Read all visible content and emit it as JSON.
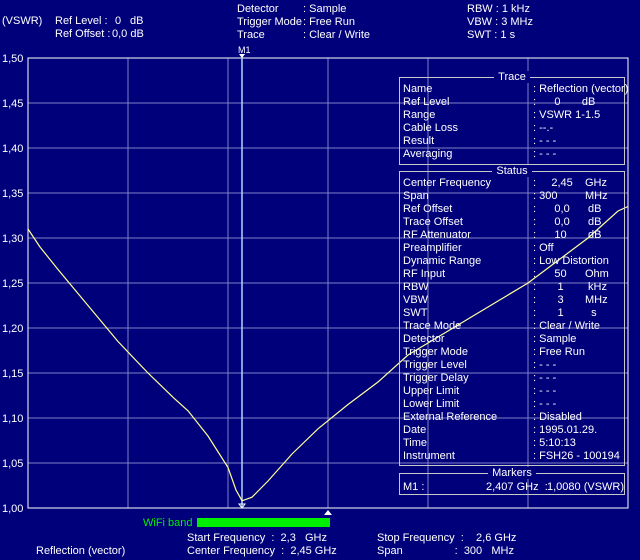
{
  "header": {
    "unit": "(VSWR)",
    "ref_level_label": "Ref Level :",
    "ref_level_value": "0",
    "ref_level_unit": "dB",
    "ref_offset_label": "Ref Offset :",
    "ref_offset_value": "0,0 dB",
    "detector_label": "Detector",
    "detector_value": ": Sample",
    "trigger_label": "Trigger Mode",
    "trigger_value": ": Free Run",
    "trace_label": "Trace",
    "trace_value": ": Clear / Write",
    "rbw": "RBW : 1 kHz",
    "vbw": "VBW : 3 MHz",
    "swt": "SWT : 1 s"
  },
  "marker_label": "M1",
  "colors": {
    "background": "#00007a",
    "trace": "#ffff99",
    "grid": "#8080c8",
    "wifi": "#00ee00",
    "marker": "#ffffff"
  },
  "chart_data": {
    "type": "line",
    "xlim": [
      2300,
      2600
    ],
    "ylim": [
      1.0,
      1.5
    ],
    "y_ticks": [
      "1,50",
      "1,45",
      "1,40",
      "1,35",
      "1,30",
      "1,25",
      "1,20",
      "1,15",
      "1,10",
      "1,05",
      "1,00"
    ],
    "marker": {
      "name": "M1",
      "x": 2407,
      "y": 1.008
    },
    "series": [
      {
        "values": [
          [
            2300,
            1.31
          ],
          [
            2306,
            1.29
          ],
          [
            2315,
            1.265
          ],
          [
            2330,
            1.225
          ],
          [
            2345,
            1.185
          ],
          [
            2360,
            1.15
          ],
          [
            2373,
            1.122
          ],
          [
            2380,
            1.108
          ],
          [
            2390,
            1.08
          ],
          [
            2400,
            1.045
          ],
          [
            2404,
            1.02
          ],
          [
            2407,
            1.008
          ],
          [
            2412,
            1.012
          ],
          [
            2420,
            1.03
          ],
          [
            2432,
            1.06
          ],
          [
            2445,
            1.088
          ],
          [
            2460,
            1.115
          ],
          [
            2475,
            1.14
          ],
          [
            2490,
            1.17
          ],
          [
            2505,
            1.19
          ],
          [
            2520,
            1.21
          ],
          [
            2535,
            1.23
          ],
          [
            2550,
            1.25
          ],
          [
            2565,
            1.275
          ],
          [
            2580,
            1.3
          ],
          [
            2595,
            1.33
          ],
          [
            2600,
            1.335
          ]
        ]
      }
    ]
  },
  "trace_panel": {
    "title": "Trace",
    "rows": [
      {
        "k": "Name",
        "v": ": Reflection (vector)"
      },
      {
        "k": "Ref Level",
        "v": ":      0       dB"
      },
      {
        "k": "Range",
        "v": ": VSWR 1-1.5"
      },
      {
        "k": "Cable Loss",
        "v": ": --.-"
      },
      {
        "k": "Result",
        "v": ": - - -"
      },
      {
        "k": "Averaging",
        "v": ": - - -"
      }
    ]
  },
  "status_panel": {
    "title": "Status",
    "rows": [
      {
        "k": "Center Frequency",
        "v": ":     2,45    GHz"
      },
      {
        "k": "Span",
        "v": ": 300         MHz"
      },
      {
        "k": "Ref Offset",
        "v": ":      0,0      dB"
      },
      {
        "k": "Trace Offset",
        "v": ":      0,0      dB"
      },
      {
        "k": "RF Attenuator",
        "v": ":      10       dB"
      },
      {
        "k": "Preamplifier",
        "v": ": Off"
      },
      {
        "k": "Dynamic Range",
        "v": ": Low Distortion"
      },
      {
        "k": "RF Input",
        "v": ":      50      Ohm"
      },
      {
        "k": "RBW",
        "v": ":       1        kHz"
      },
      {
        "k": "VBW",
        "v": ":       3       MHz"
      },
      {
        "k": "SWT",
        "v": ":       1         s"
      },
      {
        "k": "Trace Mode",
        "v": ": Clear / Write"
      },
      {
        "k": "Detector",
        "v": ": Sample"
      },
      {
        "k": "Trigger Mode",
        "v": ": Free Run"
      },
      {
        "k": "Trigger Level",
        "v": ": - - -"
      },
      {
        "k": "Trigger Delay",
        "v": ": - - -"
      },
      {
        "k": "Upper Limit",
        "v": ": - - -"
      },
      {
        "k": "Lower Limit",
        "v": ": - - -"
      },
      {
        "k": "External Reference",
        "v": ": Disabled"
      },
      {
        "k": "Date",
        "v": ": 1995.01.29."
      },
      {
        "k": "Time",
        "v": ": 5:10:13"
      },
      {
        "k": "Instrument",
        "v": ": FSH26 - 100194"
      }
    ]
  },
  "markers_panel": {
    "title": "Markers",
    "name": "M1 :",
    "freq": "2,407 GHz  :",
    "value": "1,0080 (VSWR)"
  },
  "footer": {
    "wifi_label": "WiFi band",
    "start_freq": "Start Frequency  :  2,3   GHz",
    "center_freq": "Center Frequency  :  2,45 GHz",
    "stop_freq": "Stop Frequency  :    2,6 GHz",
    "span": "Span                 :  300   MHz",
    "mode": "Reflection (vector)"
  }
}
